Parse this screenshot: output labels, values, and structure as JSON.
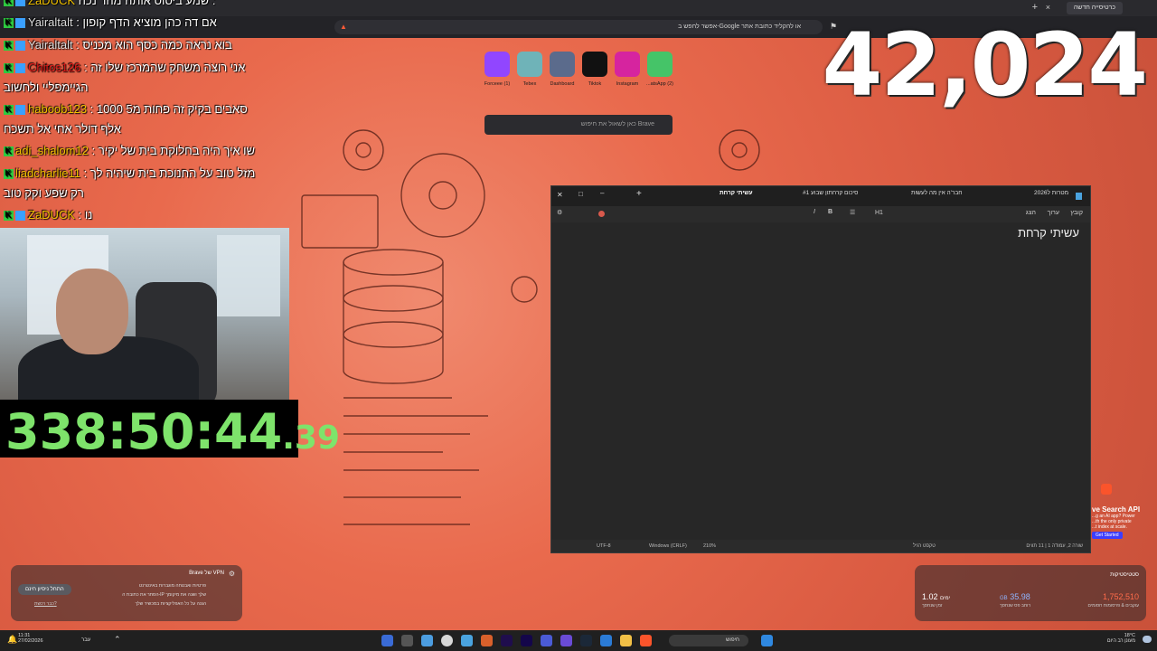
{
  "browser": {
    "active_tab": "כרטיסייה חדשה",
    "address_placeholder": "אפשר לחפש ב-Google או להקליד כתובת אתר",
    "search_placeholder": "כאן לשאול את חיפוש Brave"
  },
  "shortcuts": [
    {
      "label": "Forceee (1)",
      "color": "#9146ff"
    },
    {
      "label": "Tebex",
      "color": "#6fb3b8"
    },
    {
      "label": "Dashboard",
      "color": "#5b6b8c"
    },
    {
      "label": "Tiktok",
      "color": "#111111"
    },
    {
      "label": "Instagram",
      "color": "#d6249f"
    },
    {
      "label": "...atsApp (2)",
      "color": "#45c468"
    }
  ],
  "counter": "42,024",
  "chat": [
    {
      "user": "ZaDUCK",
      "msg": "שמע ביסוס אותה מהר נכה :",
      "user_color": "#f2c100"
    },
    {
      "user": "Yairaltalt",
      "msg": ": אם דה כהן מוציא הדף קופון",
      "user_color": "#dddddd"
    },
    {
      "user": "Yairaltalt",
      "msg": ": בוא נראה כמה כסף הוא מכניס",
      "user_color": "#dddddd"
    },
    {
      "user": "Chitos126",
      "msg": ": אני רוצה משחק שהמרכז שלו זה",
      "user_color": "#e01818"
    },
    {
      "user": "",
      "msg": "הגיימפליי ולחשוב",
      "user_color": "#ffffff"
    },
    {
      "user": "haboob123",
      "msg": ": סאבים בקיק זה פחות מ5 1000",
      "user_color": "#f2c100"
    },
    {
      "user": "",
      "msg": "אלף דולר אחי אל תשכח",
      "user_color": "#ffffff"
    },
    {
      "user": "adi_shalom12",
      "msg": ": שו איך היה בחלוקת בית של יקיר",
      "user_color": "#f2c100"
    },
    {
      "user": "liadcharlie11",
      "msg": ": מזל טוב על החנוכת בית שיהיה לך",
      "user_color": "#f2c100"
    },
    {
      "user": "",
      "msg": "רק שפע וקק טוב",
      "user_color": "#ffffff"
    },
    {
      "user": "ZaDUCK",
      "msg": ": נו",
      "user_color": "#f2c100"
    }
  ],
  "timer": {
    "main": "338:50:44",
    "fraction": ".39"
  },
  "notepad": {
    "tabs": [
      "מטרות ל2026",
      "חבר'ה אין מה לעשות",
      "סיכום קרחתון שבוע #1",
      "עשיתי קרחת"
    ],
    "menu": [
      "קובץ",
      "ערוך",
      "הצג"
    ],
    "format_h1": "H1",
    "body_text": "עשיתי קרחת",
    "status": {
      "position": "שורה 2, עמודה 1",
      "chars": "11 תווים",
      "format": "טקסט רגיל",
      "zoom": "210%",
      "line_endings": "Windows (CRLF)",
      "encoding": "UTF-8"
    }
  },
  "promo": {
    "title": "ve Search API",
    "lines": [
      "...g an AI app? Power",
      "...th the only private",
      "...t index at scale."
    ],
    "button": "Get Started"
  },
  "vpn": {
    "title": "Brave של VPN",
    "lines": [
      "פרטיות ואבטחה מוגברות באינטרנט",
      "הסתר את כתובת ה-IP שלך ושנה את מיקומך",
      "הגנה על כל האפליקציות במכשיר שלך"
    ],
    "button": "התחל ניסיון חינם",
    "link": "כבר רכשת?"
  },
  "stats": {
    "title": "סטטיסטיקות",
    "items": [
      {
        "value": "1,752,510",
        "label": "עוקבים & פרסומות חסומים",
        "color": "#ff6b4a"
      },
      {
        "value": "35.98",
        "unit": "GB",
        "label": "רוחב פס שנחסך",
        "color": "#8fb5ff"
      },
      {
        "value": "1.02",
        "unit": "ימים",
        "label": "זמן שנחסך",
        "color": "#ffffff"
      }
    ]
  },
  "taskbar": {
    "time": "11:31",
    "date": "27/02/2026",
    "search_label": "חיפוש",
    "weather": "18°C",
    "weather_desc": "מעונן רב היום",
    "lang": "עבר"
  }
}
